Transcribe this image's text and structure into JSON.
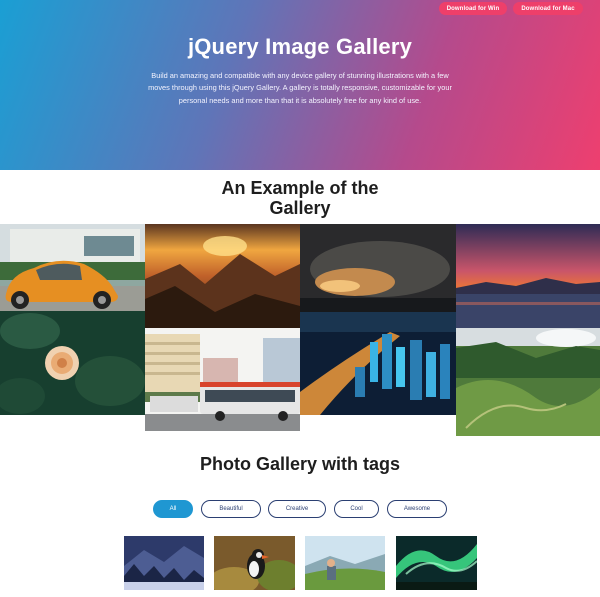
{
  "hero": {
    "title": "jQuery Image Gallery",
    "description": "Build an amazing and compatible with any device gallery of stunning illustrations with a few moves through using this jQuery Gallery. A gallery is totally responsive, customizable for your personal needs and more than that it is absolutely free for any kind of use.",
    "download_win": "Download for Win",
    "download_mac": "Download for Mac"
  },
  "example": {
    "title": "An Example of the Gallery",
    "images": [
      {
        "name": "orange-beetle-car-photo"
      },
      {
        "name": "mountain-sunset-photo"
      },
      {
        "name": "cloudy-sky-photo"
      },
      {
        "name": "lake-sunset-photo"
      },
      {
        "name": "white-rose-photo"
      },
      {
        "name": "city-bus-photo"
      },
      {
        "name": "night-city-aerial-photo"
      },
      {
        "name": "green-valley-photo"
      }
    ]
  },
  "tags_section": {
    "title": "Photo Gallery with tags",
    "tags": [
      {
        "label": "All",
        "active": true
      },
      {
        "label": "Beautiful",
        "active": false
      },
      {
        "label": "Creative",
        "active": false
      },
      {
        "label": "Cool",
        "active": false
      },
      {
        "label": "Awesome",
        "active": false
      }
    ],
    "thumbnails": [
      {
        "name": "snowy-forest-photo"
      },
      {
        "name": "puffin-bird-photo"
      },
      {
        "name": "hiker-meadow-photo"
      },
      {
        "name": "aurora-photo"
      }
    ]
  },
  "colors": {
    "gradient_start": "#1a9fd4",
    "gradient_end": "#ee3f6f",
    "download_button": "#ee3f6a",
    "tag_active": "#1f97d2",
    "tag_border": "#2b3f72"
  }
}
